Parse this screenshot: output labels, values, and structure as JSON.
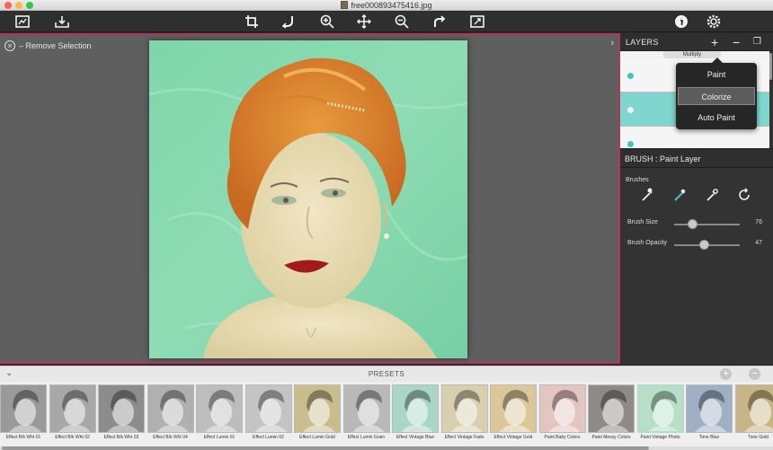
{
  "window": {
    "title": "free000893475416.jpg"
  },
  "toolbar": {
    "left_icons": [
      "open-image-icon",
      "save-icon"
    ],
    "center_icons": [
      "crop-icon",
      "rotate-left-icon",
      "zoom-in-icon",
      "move-icon",
      "zoom-out-icon",
      "redo-icon",
      "fit-icon"
    ],
    "right_icons": [
      "info-icon",
      "settings-icon"
    ]
  },
  "workspace": {
    "remove_selection_label": "– Remove Selection",
    "collapse_glyph": "›"
  },
  "layers": {
    "title": "LAYERS",
    "add_glyph": "+",
    "remove_glyph": "−",
    "duplicate_glyph": "❐",
    "blend_mode": "Multiply",
    "menu": [
      "Paint",
      "Colorize",
      "Auto Paint"
    ],
    "menu_selected": "Colorize"
  },
  "brush": {
    "title": "BRUSH : Paint Layer",
    "brushes_label": "Brushes",
    "sliders": [
      {
        "label": "Brush Size",
        "value": 76,
        "fraction": 0.28
      },
      {
        "label": "Brush Opacity",
        "value": 47,
        "fraction": 0.45
      }
    ]
  },
  "presets": {
    "title": "PRESETS",
    "items": [
      {
        "caption": "Effect B/k Wht 01",
        "tint": "#9a9a9a"
      },
      {
        "caption": "Effect B/k Wht 02",
        "tint": "#a8a8a8"
      },
      {
        "caption": "Effect B/k Wht 03",
        "tint": "#8c8c8c"
      },
      {
        "caption": "Effect B/k Wht 04",
        "tint": "#b0b0b0"
      },
      {
        "caption": "Effect Lumin 01",
        "tint": "#bdbdbd"
      },
      {
        "caption": "Effect Lumin 02",
        "tint": "#c4c4c4"
      },
      {
        "caption": "Effect Lumin Gold",
        "tint": "#c9bd8e"
      },
      {
        "caption": "Effect Lumin Grain",
        "tint": "#b9b9b9"
      },
      {
        "caption": "Effect Vintage Blue",
        "tint": "#a9d6c8"
      },
      {
        "caption": "Effect Vintage Fade",
        "tint": "#d8cfae"
      },
      {
        "caption": "Effect Vintage Gold",
        "tint": "#dcc79a"
      },
      {
        "caption": "Paint Baby Colors",
        "tint": "#e3c5c2"
      },
      {
        "caption": "Paint Messy Colors",
        "tint": "#8f8a86"
      },
      {
        "caption": "Paint Vintage Photo",
        "tint": "#b7dfc7"
      },
      {
        "caption": "Tone Blue",
        "tint": "#9fb0c4"
      },
      {
        "caption": "Tone Gold",
        "tint": "#c8b585"
      }
    ],
    "selected_index": 13
  }
}
